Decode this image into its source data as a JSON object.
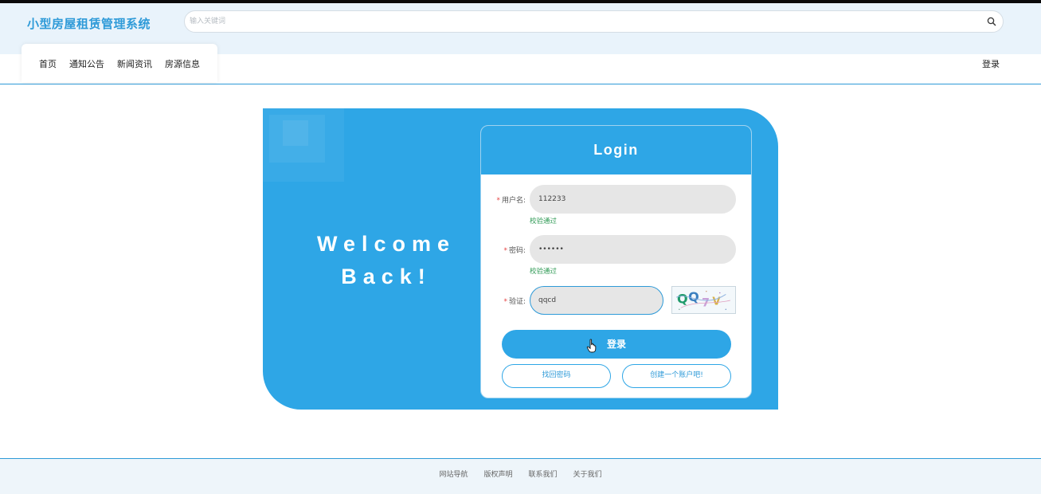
{
  "header": {
    "logo": "小型房屋租赁管理系统",
    "search_placeholder": "输入关键词"
  },
  "nav": {
    "items": [
      "首页",
      "通知公告",
      "新闻资讯",
      "房源信息"
    ],
    "login": "登录"
  },
  "hero": {
    "welcome_line1": "Welcome",
    "welcome_line2": "Back!"
  },
  "login_form": {
    "title": "Login",
    "required_mark": "*",
    "username_label": "用户名:",
    "username_value": "112233",
    "username_status": "校验通过",
    "password_label": "密码:",
    "password_value": "••••••",
    "password_status": "校验通过",
    "captcha_label": "验证:",
    "captcha_value": "qqcd",
    "captcha_text": "QQ7V",
    "submit_label": "登录",
    "forgot_label": "找回密码",
    "register_label": "创建一个账户吧!"
  },
  "footer": {
    "links": [
      "网站导航",
      "版权声明",
      "联系我们",
      "关于我们"
    ]
  },
  "colors": {
    "primary": "#2ea6e6",
    "logo": "#2e9ad8",
    "success": "#2f9a55",
    "required": "#e54545"
  }
}
